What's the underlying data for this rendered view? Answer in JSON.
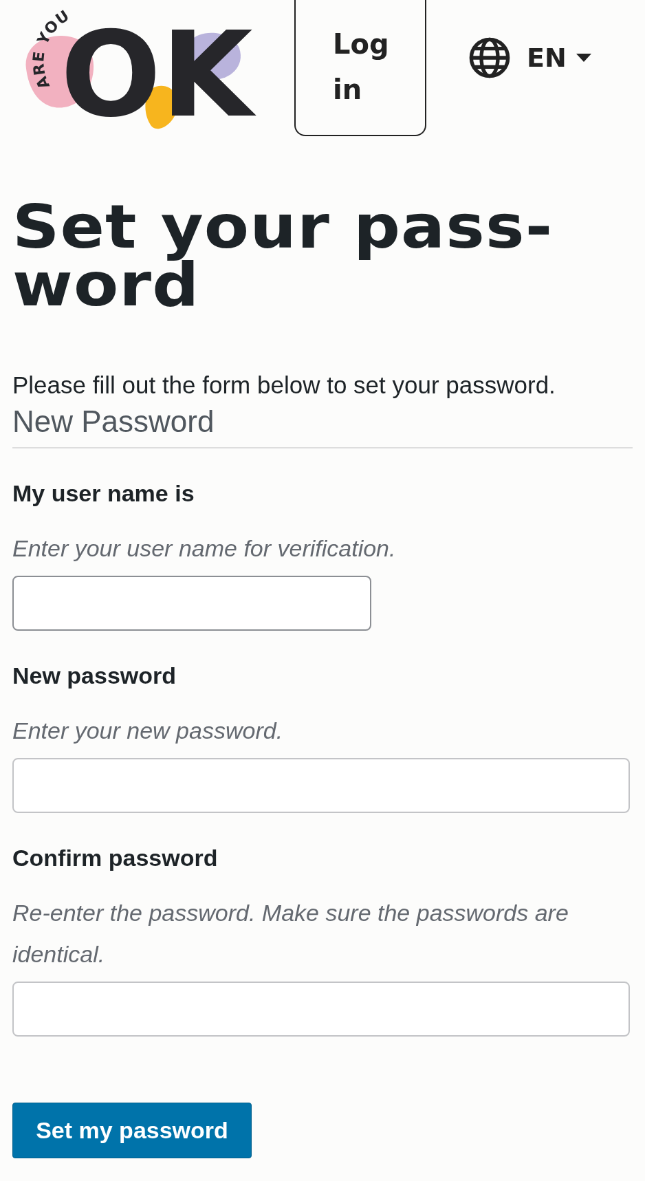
{
  "header": {
    "logo": {
      "tagline": "ARE YOU",
      "mark": "OK"
    },
    "login_button": "Log in",
    "language": {
      "code": "EN"
    }
  },
  "title": "Set your pass-word",
  "intro": "Please fill out the form below to set your password.",
  "section_title": "New Password",
  "fields": [
    {
      "kind": "text",
      "label": "My user name is",
      "hint": "Enter your user name for verification."
    },
    {
      "kind": "password",
      "label": "New password",
      "hint": "Enter your new password."
    },
    {
      "kind": "password",
      "label": "Confirm password",
      "hint": "Re-enter the password. Make sure the passwords are identical."
    }
  ],
  "submit_button": "Set my password"
}
